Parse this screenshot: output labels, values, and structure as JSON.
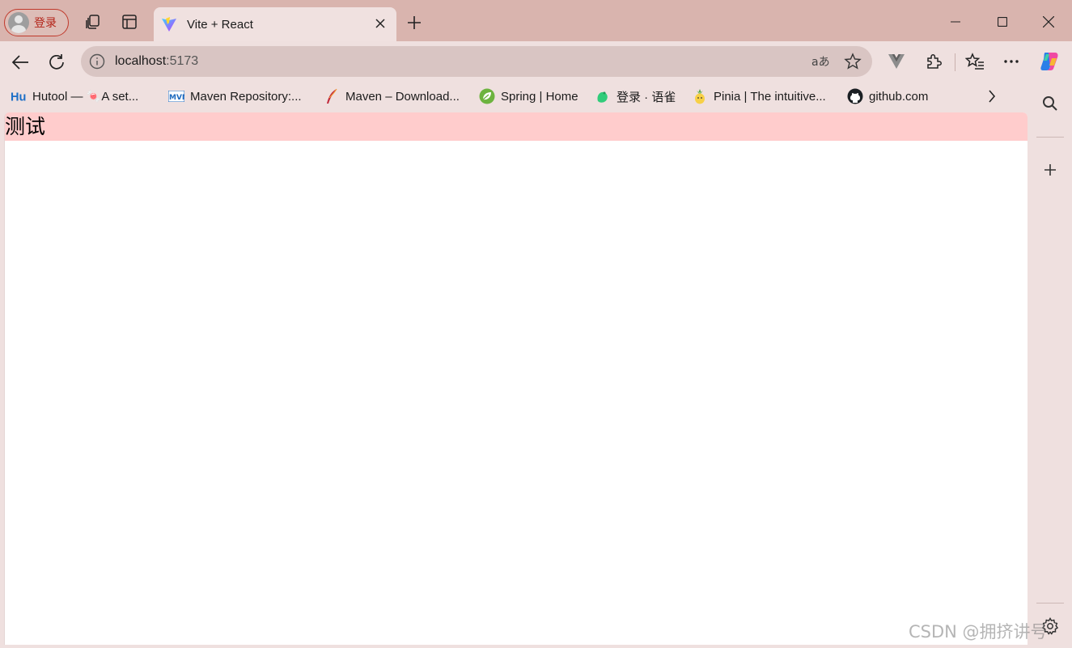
{
  "profile": {
    "label": "登录"
  },
  "tab": {
    "title": "Vite + React"
  },
  "address_bar": {
    "host": "localhost",
    "port": ":5173"
  },
  "bookmarks": [
    {
      "label": "Hutool — 🍬A set...",
      "icon": "hutool-icon"
    },
    {
      "label": "Maven Repository:...",
      "icon": "mvn-icon"
    },
    {
      "label": "Maven – Download...",
      "icon": "feather-icon"
    },
    {
      "label": "Spring | Home",
      "icon": "spring-leaf-icon"
    },
    {
      "label": "登录 · 语雀",
      "icon": "yuque-icon"
    },
    {
      "label": "Pinia | The intuitive...",
      "icon": "pineapple-icon"
    },
    {
      "label": "github.com",
      "icon": "github-icon"
    }
  ],
  "page": {
    "heading": "测试",
    "heading_background": "#ffcccc"
  },
  "watermark": "CSDN @拥挤讲号",
  "colors": {
    "tabstrip": "#d9b4ae",
    "chrome": "#efe0df",
    "profile_accent": "#c0392b"
  }
}
